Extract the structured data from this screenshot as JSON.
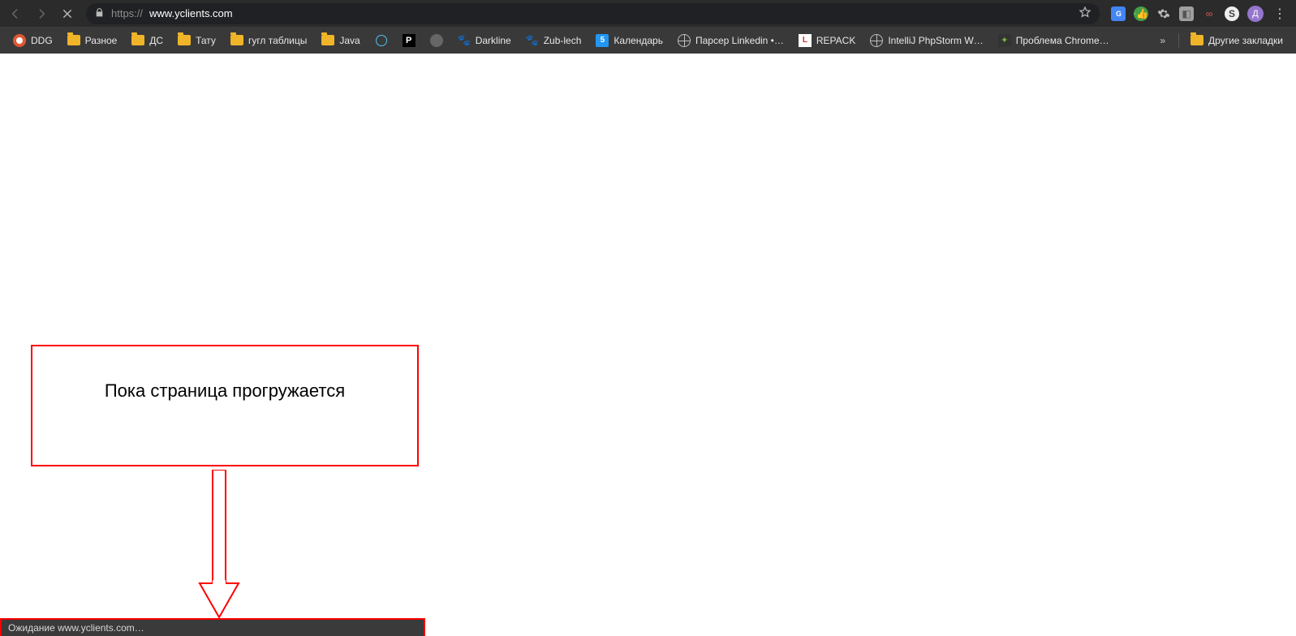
{
  "address": {
    "scheme": "https://",
    "host": "www.yclients.com"
  },
  "profile_letter": "Д",
  "bookmarks": [
    {
      "label": "DDG",
      "icon": "ddg"
    },
    {
      "label": "Разное",
      "icon": "folder"
    },
    {
      "label": "ДС",
      "icon": "folder"
    },
    {
      "label": "Тату",
      "icon": "folder"
    },
    {
      "label": "гугл таблицы",
      "icon": "folder"
    },
    {
      "label": "Java",
      "icon": "folder"
    },
    {
      "label": "",
      "icon": "java-ring"
    },
    {
      "label": "",
      "icon": "black-p"
    },
    {
      "label": "",
      "icon": "grey-ball"
    },
    {
      "label": "Darkline",
      "icon": "paw"
    },
    {
      "label": "Zub-lech",
      "icon": "paw"
    },
    {
      "label": "Календарь",
      "icon": "calendar",
      "badge": "5"
    },
    {
      "label": "Парсер Linkedin •…",
      "icon": "globe"
    },
    {
      "label": "REPACK",
      "icon": "repack"
    },
    {
      "label": "IntelliJ PhpStorm W…",
      "icon": "globe"
    },
    {
      "label": "Проблема Chrome…",
      "icon": "pix"
    }
  ],
  "other_bookmarks_label": "Другие закладки",
  "annotation_text": "Пока страница прогружается",
  "status_text": "Ожидание www.yclients.com…"
}
